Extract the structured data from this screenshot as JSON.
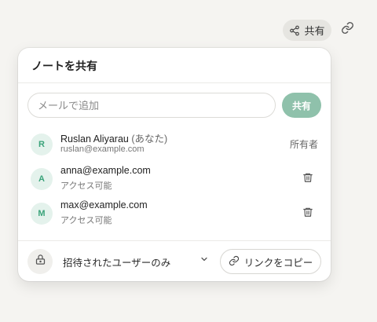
{
  "toolbar": {
    "share_label": "共有",
    "share_icon": "share-icon",
    "link_icon": "link-icon"
  },
  "panel": {
    "title": "ノートを共有",
    "email_placeholder": "メールで追加",
    "share_button": "共有",
    "colors": {
      "accent": "#8fc1ab",
      "avatar_bg": "#e4f2ec",
      "avatar_text": "#3aa37a"
    }
  },
  "members": [
    {
      "initial": "R",
      "name": "Ruslan Aliyarau",
      "you_tag": "(あなた)",
      "email": "ruslan@example.com",
      "role": "所有者"
    },
    {
      "initial": "A",
      "name": "anna@example.com",
      "access": "アクセス可能",
      "action_icon": "trash-icon"
    },
    {
      "initial": "M",
      "name": "max@example.com",
      "access": "アクセス可能",
      "action_icon": "trash-icon"
    }
  ],
  "footer": {
    "lock_icon": "lock-icon",
    "access_selected": "招待されたユーザーのみ",
    "chevron_icon": "chevron-down-icon",
    "copy_link_label": "リンクをコピー"
  }
}
